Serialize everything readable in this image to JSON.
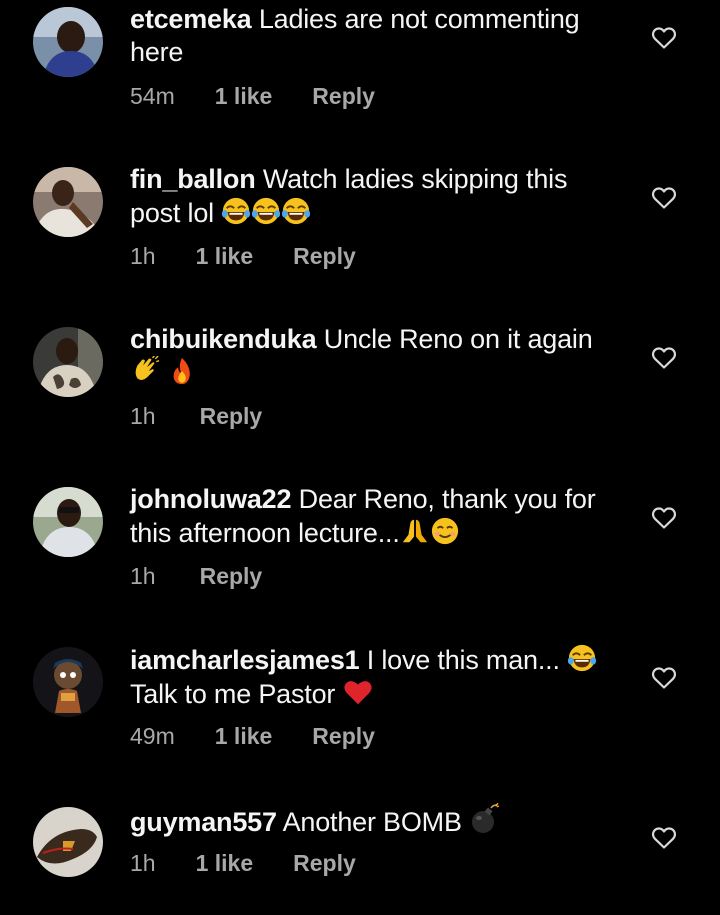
{
  "comments": [
    {
      "username": "etcemeka",
      "text": "Ladies are not commenting here",
      "time": "54m",
      "likes": "1 like",
      "reply": "Reply",
      "emojis": []
    },
    {
      "username": "fin_ballon",
      "text": "Watch ladies skipping this post lol",
      "time": "1h",
      "likes": "1 like",
      "reply": "Reply",
      "emojis": [
        "laughing-tears-emoji",
        "laughing-tears-emoji",
        "laughing-tears-emoji"
      ]
    },
    {
      "username": "chibuikenduka",
      "text": "Uncle Reno on it again",
      "time": "1h",
      "likes": "",
      "reply": "Reply",
      "emojis": [
        "clapping-hands-emoji",
        "fire-emoji"
      ]
    },
    {
      "username": "johnoluwa22",
      "text": "Dear Reno, thank you for this afternoon lecture...",
      "time": "1h",
      "likes": "",
      "reply": "Reply",
      "emojis": [
        "folded-hands-emoji",
        "smiling-emoji"
      ]
    },
    {
      "username": "iamcharlesjames1",
      "text": "I love this man...",
      "text2": "Talk to me Pastor",
      "time": "49m",
      "likes": "1 like",
      "reply": "Reply",
      "emojis": [
        "laughing-tears-emoji",
        "red-heart-emoji"
      ]
    },
    {
      "username": "guyman557",
      "text": "Another BOMB",
      "time": "1h",
      "likes": "1 like",
      "reply": "Reply",
      "emojis": [
        "bomb-emoji"
      ]
    }
  ],
  "icons": {
    "like": "heart-outline-icon"
  },
  "colors": {
    "background": "#000000",
    "text": "#f5f5f5",
    "meta": "#a8a8a8"
  }
}
